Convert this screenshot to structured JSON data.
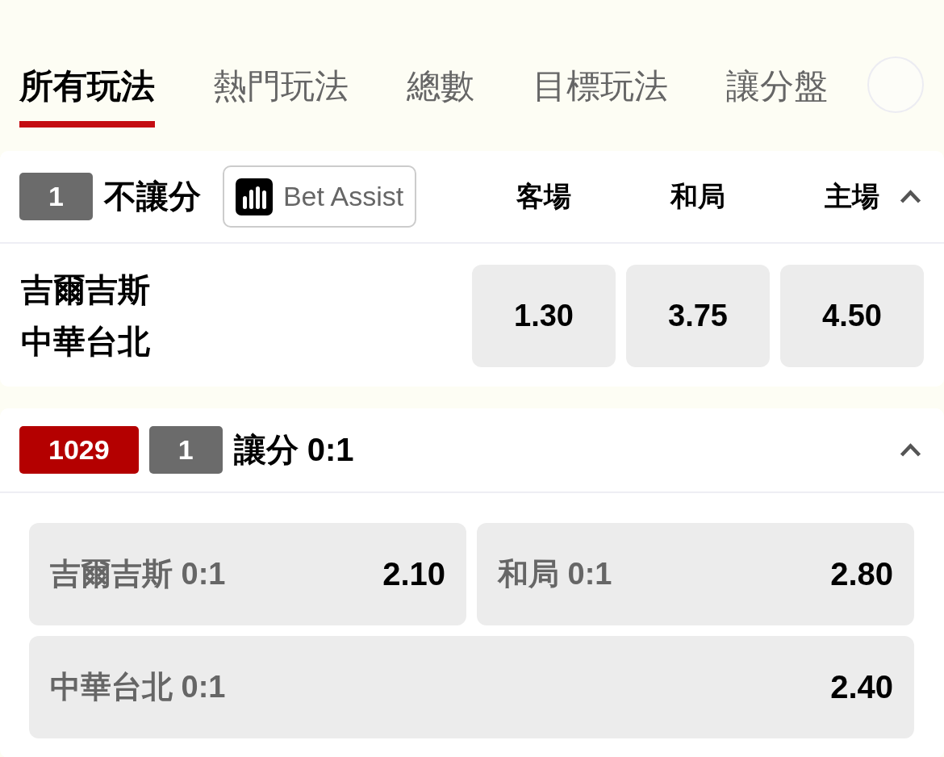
{
  "tabs": [
    {
      "label": "所有玩法",
      "selected": true
    },
    {
      "label": "熱門玩法",
      "selected": false
    },
    {
      "label": "總數",
      "selected": false
    },
    {
      "label": "目標玩法",
      "selected": false
    },
    {
      "label": "讓分盤",
      "selected": false
    }
  ],
  "markets": [
    {
      "kind": "three_way",
      "badges": [
        {
          "kind": "count",
          "text": "1"
        }
      ],
      "title": "不讓分",
      "bet_assist": "Bet Assist",
      "columns": [
        "客場",
        "和局",
        "主場"
      ],
      "expanded": true,
      "rows": [
        {
          "teams": [
            "吉爾吉斯",
            "中華台北"
          ],
          "odds": [
            "1.30",
            "3.75",
            "4.50"
          ]
        }
      ]
    },
    {
      "kind": "handicap",
      "badges": [
        {
          "kind": "event_id",
          "text": "1029"
        },
        {
          "kind": "count",
          "text": "1"
        }
      ],
      "title": "讓分 0:1",
      "expanded": true,
      "options": [
        {
          "label": "吉爾吉斯 0:1",
          "odds": "2.10"
        },
        {
          "label": "和局 0:1",
          "odds": "2.80"
        },
        {
          "label": "中華台北 0:1",
          "odds": "2.40"
        }
      ]
    }
  ]
}
